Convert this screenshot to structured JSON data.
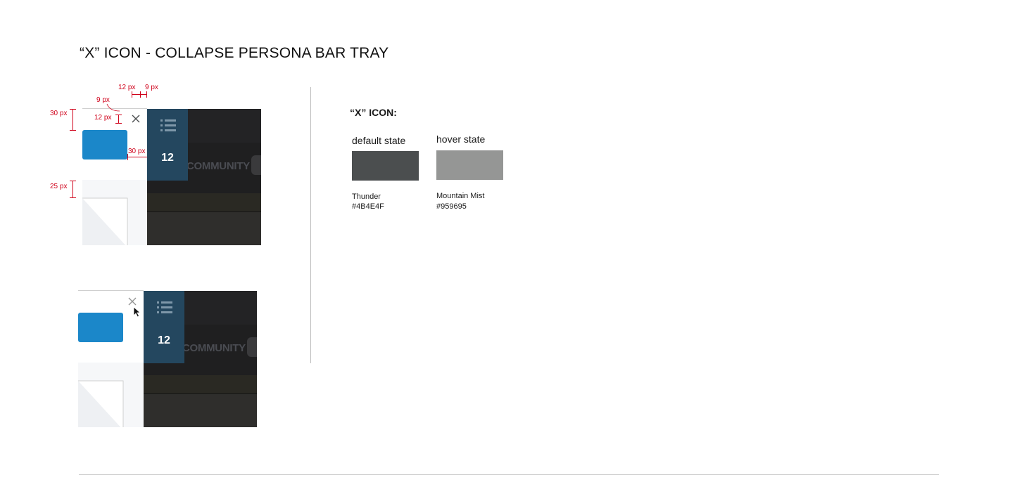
{
  "title": "“X” ICON - COLLAPSE PERSONA BAR TRAY",
  "mockups": {
    "tray_count": "12",
    "community_text": "COMMUNITY"
  },
  "measurements": {
    "top_a": "12 px",
    "top_b": "9 px",
    "offset_top": "9 px",
    "height_30": "30 px",
    "icon_12": "12 px",
    "right_30": "30 px",
    "gap_25": "25 px"
  },
  "spec": {
    "heading": "“X” ICON:",
    "states": [
      {
        "label": "default state",
        "color_name": "Thunder",
        "hex": "#4B4E4F",
        "color": "#4B4E4F"
      },
      {
        "label": "hover state",
        "color_name": "Mountain Mist",
        "hex": "#959695",
        "color": "#959695"
      }
    ]
  },
  "colors": {
    "tray": "#24475F",
    "button_blue": "#1B87C9",
    "annotation_red": "#D0021B"
  }
}
